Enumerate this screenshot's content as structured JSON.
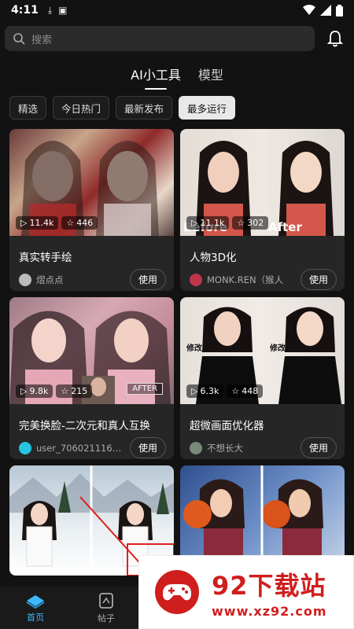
{
  "status": {
    "time": "4:11"
  },
  "search": {
    "placeholder": "搜索"
  },
  "tabs": [
    {
      "label": "AI小工具"
    },
    {
      "label": "模型"
    }
  ],
  "chips": [
    {
      "label": "精选"
    },
    {
      "label": "今日热门"
    },
    {
      "label": "最新发布"
    },
    {
      "label": "最多运行"
    }
  ],
  "cards": [
    {
      "title": "真实转手绘",
      "author": "熠点点",
      "views": "11.4k",
      "stars": "446",
      "use": "使用"
    },
    {
      "title": "人物3D化",
      "author": "MONK.REN（猴人",
      "views": "11.1k",
      "stars": "302",
      "use": "使用",
      "before": "Before",
      "after": "After"
    },
    {
      "title": "完美换脸-二次元和真人互换",
      "author": "user_7060211165…",
      "views": "9.8k",
      "stars": "215",
      "use": "使用",
      "after": "AFTER"
    },
    {
      "title": "超微画面优化器",
      "author": "不想长大",
      "views": "6.3k",
      "stars": "448",
      "use": "使用",
      "before": "修改前",
      "after": "修改后"
    }
  ],
  "bottom_nav": [
    {
      "label": "首页"
    },
    {
      "label": "帖子"
    }
  ],
  "watermark": {
    "title": "92下载站",
    "url": "www.xz92.com"
  },
  "colors": {
    "accent": "#3fb7ff",
    "watermark": "#d01e1e"
  }
}
